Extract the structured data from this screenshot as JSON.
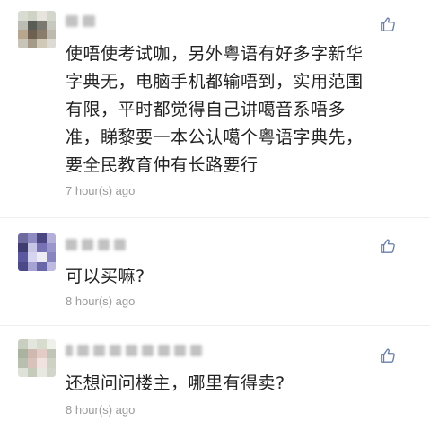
{
  "comments": [
    {
      "text": "使唔使考试咖，另外粤语有好多字新华\n字典无，电脑手机都输唔到，实用范围\n有限，平时都觉得自己讲噶音系唔多\n准，睇黎要一本公认噶个粤语字典先，\n要全民教育仲有长路要行",
      "time": "7 hour(s) ago"
    },
    {
      "text": "可以买嘛?",
      "time": "8 hour(s) ago"
    },
    {
      "text": "还想问问楼主，哪里有得卖?",
      "time": "8 hour(s) ago"
    }
  ],
  "colors": {
    "like_icon": "#6a7fa8",
    "time": "#9a9a9a",
    "text": "#222222"
  },
  "icons": {
    "like": "thumbs-up-icon"
  }
}
